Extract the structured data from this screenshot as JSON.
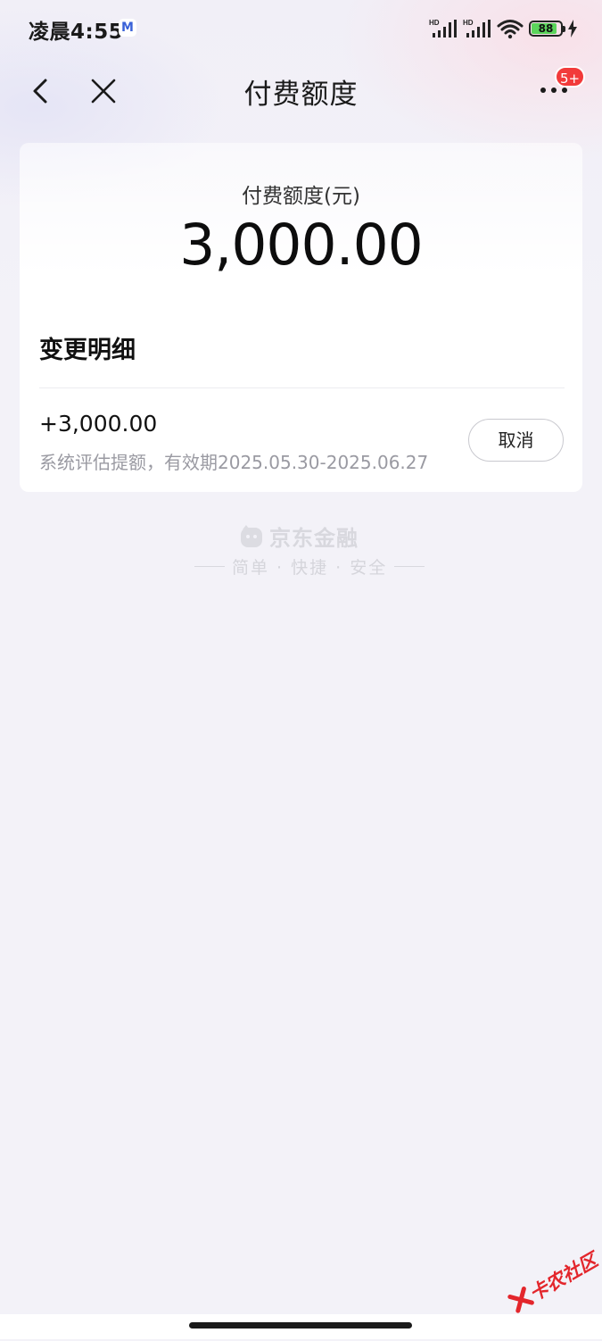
{
  "status_bar": {
    "time": "凌晨4:55",
    "notification_app_letter": "M",
    "battery_level": "88"
  },
  "nav": {
    "title": "付费额度",
    "more_badge": "5+"
  },
  "quota": {
    "label": "付费额度(元)",
    "amount": "3,000.00"
  },
  "changes": {
    "title": "变更明细",
    "records": [
      {
        "amount": "+3,000.00",
        "description": "系统评估提额，有效期2025.05.30-2025.06.27",
        "action_label": "取消"
      }
    ]
  },
  "brand": {
    "name": "京东金融",
    "slogan": "简单 · 快捷 · 安全"
  },
  "watermark": {
    "text": "卡农社区"
  },
  "colors": {
    "badge": "#f23a3a",
    "battery_fill": "#5bd45b",
    "stamp": "#e3262c"
  }
}
